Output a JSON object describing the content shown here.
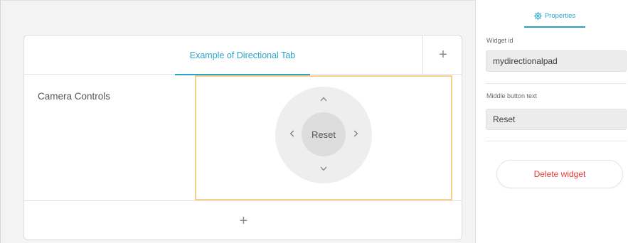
{
  "canvas": {
    "tab": {
      "label": "Example of Directional Tab"
    },
    "tab_add": "+",
    "row": {
      "label": "Camera Controls"
    },
    "widget": {
      "up": "^",
      "down": "v",
      "left": "<",
      "right": ">",
      "middle_text": "Reset"
    },
    "row_add": "+"
  },
  "sidebar": {
    "tab_label": "Properties",
    "tab_icon": "gear-icon",
    "fields": [
      {
        "label": "Widget id",
        "value": "mydirectionalpad"
      },
      {
        "label": "Middle button text",
        "value": "Reset"
      }
    ],
    "delete_label": "Delete widget"
  },
  "colors": {
    "accent": "#2aa3c8",
    "delete": "#e53935",
    "selection_border": "#f7cf88"
  }
}
